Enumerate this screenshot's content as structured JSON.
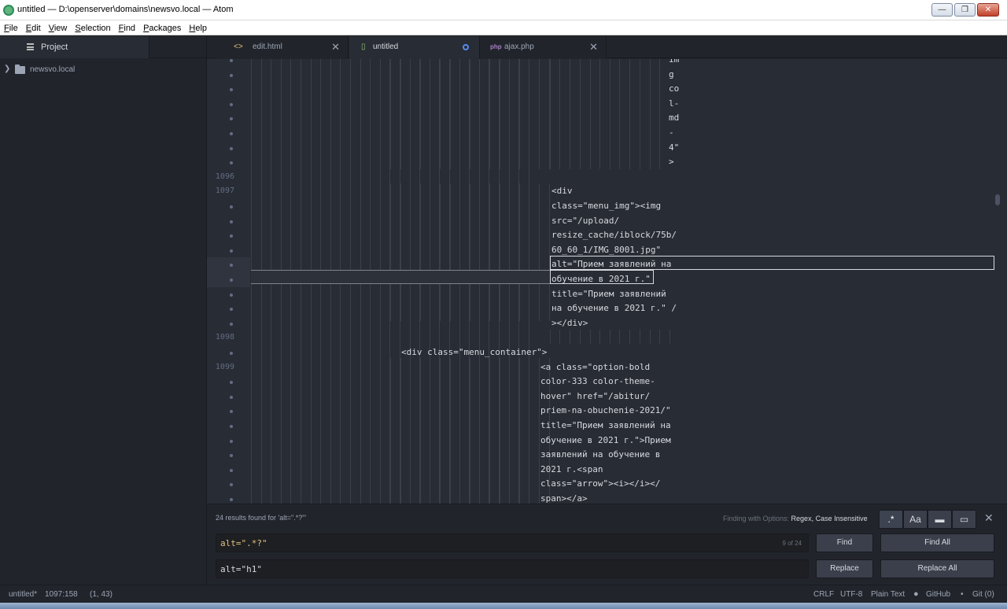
{
  "window": {
    "title": "untitled — D:\\openserver\\domains\\newsvo.local — Atom",
    "controls": [
      "—",
      "❐",
      "✕"
    ]
  },
  "menu": [
    "File",
    "Edit",
    "View",
    "Selection",
    "Find",
    "Packages",
    "Help"
  ],
  "tree": {
    "header": "Project",
    "root_folder": "newsvo.local"
  },
  "tabs": [
    {
      "label": "edit.html",
      "icon": "<>",
      "icon_color": "#e5c07b"
    },
    {
      "label": "untitled",
      "icon": "▯",
      "icon_color": "#98c379"
    },
    {
      "label": "ajax.php",
      "icon": "php",
      "icon_color": "#a67fc5"
    }
  ],
  "gutter": {
    "line_1096": "1096",
    "line_1097": "1097",
    "line_1098": "1098",
    "line_1099": "1099"
  },
  "code": {
    "l0": "im",
    "l1": "g",
    "l2": "co",
    "l3": "l-",
    "l4": "md",
    "l5": "-",
    "l6": "4\"",
    "l7": ">",
    "l9": "<div",
    "l10": "class=\"menu_img\"><img",
    "l11": "src=\"/upload/",
    "l12": "resize_cache/iblock/75b/",
    "l13": "60_60_1/IMG_8001.jpg\"",
    "l14": "alt=\"Прием заявлений на",
    "l15": "обучение в 2021 г.\"",
    "l16": "title=\"Прием заявлений",
    "l17": "на обучение в 2021 г.\" /",
    "l18": "></div>",
    "l20": "<div class=\"menu_container\">",
    "l21": "<a class=\"option-bold",
    "l22": "color-333 color-theme-",
    "l23": "hover\" href=\"/abitur/",
    "l24": "priem-na-obuchenie-2021/\"",
    "l25": "title=\"Прием заявлений на",
    "l26": "обучение в 2021 г.\">Прием",
    "l27": "заявлений на обучение в",
    "l28": "2021 г.<span",
    "l29": "class=\"arrow\"><i></i></",
    "l30": "span></a>"
  },
  "find": {
    "results": "24 results found for 'alt=\".*?\"'",
    "options_prefix": "Finding with Options: ",
    "options_value": "Regex, Case Insensitive",
    "find_value": "alt=\".*?\"",
    "match_count": "9 of 24",
    "replace_value": "alt=\"h1\"",
    "btn_find": "Find",
    "btn_find_all": "Find All",
    "btn_replace": "Replace",
    "btn_replace_all": "Replace All",
    "opt_regex": ".*",
    "opt_case": "Aa",
    "opt_selection": "▬",
    "opt_word": "▭",
    "close": "✕"
  },
  "status": {
    "file": "untitled*",
    "cursor": "1097:158",
    "selection": "(1, 43)",
    "line_ending": "CRLF",
    "encoding": "UTF-8",
    "grammar": "Plain Text",
    "github": "GitHub",
    "git": "Git (0)"
  }
}
